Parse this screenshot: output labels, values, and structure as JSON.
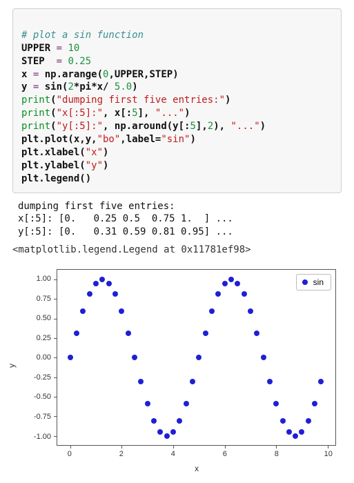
{
  "code": {
    "comment": "# plot a sin function",
    "line2": {
      "var": "UPPER",
      "op": "=",
      "num": "10"
    },
    "line3": {
      "var": "STEP",
      "op": "=",
      "num": "0.25"
    },
    "line4": {
      "lhs": "x",
      "op": "=",
      "rhs_a": "np.arange(",
      "n0": "0",
      "c1": ",UPPER,STEP)"
    },
    "line5": {
      "lhs": "y",
      "op": "=",
      "rhs_a": "sin(",
      "n2": "2",
      "mid": "*pi*x/ ",
      "n5": "5.0",
      "end": ")"
    },
    "line6": {
      "fn": "print",
      "open": "(",
      "str": "\"dumping first five entries:\"",
      "close": ")"
    },
    "line7": {
      "fn": "print",
      "open": "(",
      "str": "\"x[:5]:\"",
      "mid": ", x[:",
      "n5": "5",
      "m2": "], ",
      "dots": "\"...\"",
      "close": ")"
    },
    "line8": {
      "fn": "print",
      "open": "(",
      "str": "\"y[:5]:\"",
      "mid": ", np.around(y[:",
      "n5": "5",
      "m2": "],",
      "n2": "2",
      "m3": "), ",
      "dots": "\"...\"",
      "close": ")"
    },
    "line9": {
      "a": "plt.plot(x,y,",
      "s1": "\"bo\"",
      "b": ",label=",
      "s2": "\"sin\"",
      "c": ")"
    },
    "line10": {
      "a": "plt.xlabel(",
      "s": "\"x\"",
      "b": ")"
    },
    "line11": {
      "a": "plt.ylabel(",
      "s": "\"y\"",
      "b": ")"
    },
    "line12": {
      "a": "plt.legend()"
    }
  },
  "stdout": {
    "l1": "dumping first five entries:",
    "l2": "x[:5]: [0.   0.25 0.5  0.75 1.  ] ...",
    "l3": "y[:5]: [0.   0.31 0.59 0.81 0.95] ..."
  },
  "repr": "<matplotlib.legend.Legend at 0x11781ef98>",
  "chart_data": {
    "type": "scatter",
    "title": "",
    "xlabel": "x",
    "ylabel": "y",
    "xlim": [
      -0.5,
      10.3
    ],
    "ylim": [
      -1.12,
      1.12
    ],
    "xticks": [
      0,
      2,
      4,
      6,
      8,
      10
    ],
    "yticks": [
      -1.0,
      -0.75,
      -0.5,
      -0.25,
      0.0,
      0.25,
      0.5,
      0.75,
      1.0
    ],
    "legend": "sin",
    "series": [
      {
        "name": "sin",
        "marker": "bo",
        "x": [
          0,
          0.25,
          0.5,
          0.75,
          1,
          1.25,
          1.5,
          1.75,
          2,
          2.25,
          2.5,
          2.75,
          3,
          3.25,
          3.5,
          3.75,
          4,
          4.25,
          4.5,
          4.75,
          5,
          5.25,
          5.5,
          5.75,
          6,
          6.25,
          6.5,
          6.75,
          7,
          7.25,
          7.5,
          7.75,
          8,
          8.25,
          8.5,
          8.75,
          9,
          9.25,
          9.5,
          9.75
        ],
        "y": [
          0.0,
          0.31,
          0.59,
          0.81,
          0.95,
          1.0,
          0.95,
          0.81,
          0.59,
          0.31,
          0.0,
          -0.31,
          -0.59,
          -0.81,
          -0.95,
          -1.0,
          -0.95,
          -0.81,
          -0.59,
          -0.31,
          0.0,
          0.31,
          0.59,
          0.81,
          0.95,
          1.0,
          0.95,
          0.81,
          0.59,
          0.31,
          0.0,
          -0.31,
          -0.59,
          -0.81,
          -0.95,
          -1.0,
          -0.95,
          -0.81,
          -0.59,
          -0.31
        ]
      }
    ]
  }
}
